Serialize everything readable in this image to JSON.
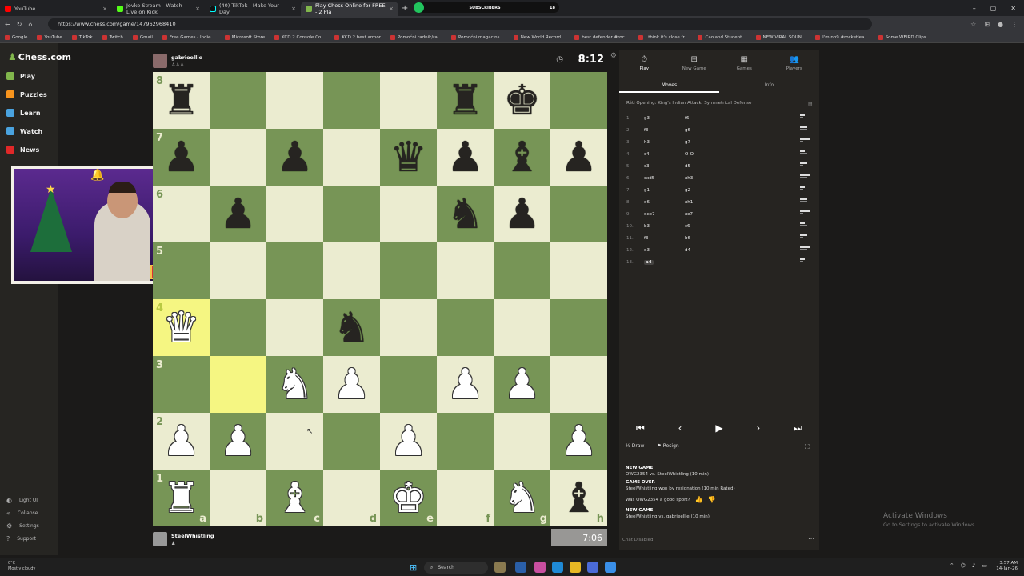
{
  "browser": {
    "tabs": [
      {
        "label": "YouTube",
        "color": "#ff0000"
      },
      {
        "label": "Jovke Stream - Watch Live on Kick",
        "color": "#53fc18"
      },
      {
        "label": "(40) TikTok - Make Your Day",
        "color": "#111111"
      },
      {
        "label": "Play Chess Online for FREE - 2 Pla",
        "color": "#81b64c",
        "active": true
      }
    ],
    "subscribers_label": "SUBSCRIBERS",
    "subscribers_count": "18",
    "url": "https://www.chess.com/game/147962968410",
    "bookmarks": [
      "Google",
      "YouTube",
      "TikTok",
      "Twitch",
      "Gmail",
      "Free Games - Indie...",
      "Microsoft Store",
      "KCD 2 Console Co...",
      "KCD 2 best armor",
      "Pomoćni radnik/ra...",
      "Pomoćni magacins...",
      "New World Record...",
      "best defender #roc...",
      "I think it's close fr...",
      "Caoland Student...",
      "NEW VIRAL SOUN...",
      "I'm no9 #rocketlea...",
      "Some WEIRD Clips..."
    ]
  },
  "sidebar": {
    "logo": "Chess.com",
    "nav": [
      {
        "label": "Play",
        "icon": "play-icon",
        "color": "#81b64c"
      },
      {
        "label": "Puzzles",
        "icon": "puzzle-icon",
        "color": "#f7941d"
      },
      {
        "label": "Learn",
        "icon": "learn-icon",
        "color": "#4aa3df"
      },
      {
        "label": "Watch",
        "icon": "watch-icon",
        "color": "#4aa3df"
      },
      {
        "label": "News",
        "icon": "news-icon",
        "color": "#e02828"
      }
    ],
    "bottom": [
      "Light UI",
      "Collapse",
      "Settings",
      "Support"
    ]
  },
  "game": {
    "top_player": "gabrieellie",
    "top_clock": "8:12",
    "bottom_player": "SteelWhistling",
    "bottom_clock": "7:06",
    "files": [
      "a",
      "b",
      "c",
      "d",
      "e",
      "f",
      "g",
      "h"
    ],
    "ranks": [
      "8",
      "7",
      "6",
      "5",
      "4",
      "3",
      "2",
      "1"
    ],
    "board": [
      [
        "bR",
        "",
        "",
        "",
        "",
        "bR",
        "bK",
        ""
      ],
      [
        "bP",
        "",
        "bP",
        "",
        "bQ",
        "bP",
        "bB",
        "bP"
      ],
      [
        "",
        "bP",
        "",
        "",
        "",
        "bN",
        "bP",
        ""
      ],
      [
        "",
        "",
        "",
        "",
        "",
        "",
        "",
        ""
      ],
      [
        "wQ",
        "",
        "",
        "bN",
        "",
        "",
        "",
        ""
      ],
      [
        "",
        "",
        "wN",
        "wP",
        "",
        "wP",
        "wP",
        ""
      ],
      [
        "wP",
        "wP",
        "",
        "",
        "wP",
        "",
        "",
        "wP"
      ],
      [
        "wR",
        "",
        "wB",
        "",
        "wK",
        "",
        "wN",
        "bB"
      ]
    ],
    "highlights": [
      "a4",
      "b3"
    ]
  },
  "panel": {
    "tabs": [
      {
        "label": "Play",
        "icon": "stopwatch-icon",
        "active": true
      },
      {
        "label": "New Game",
        "icon": "plus-icon"
      },
      {
        "label": "Games",
        "icon": "games-icon"
      },
      {
        "label": "Players",
        "icon": "players-icon"
      }
    ],
    "move_tabs": [
      "Moves",
      "Info"
    ],
    "opening": "Réti Opening: King's Indian Attack, Symmetrical Defense",
    "moves": [
      {
        "n": "1.",
        "w": "g3",
        "b": "f6"
      },
      {
        "n": "2.",
        "w": "f3",
        "b": "g6"
      },
      {
        "n": "3.",
        "w": "h3",
        "b": "g7"
      },
      {
        "n": "4.",
        "w": "c4",
        "b": "O-O"
      },
      {
        "n": "5.",
        "w": "c3",
        "b": "d5"
      },
      {
        "n": "6.",
        "w": "cxd5",
        "b": "xh3"
      },
      {
        "n": "7.",
        "w": "g1",
        "b": "g2"
      },
      {
        "n": "8.",
        "w": "d6",
        "b": "xh1"
      },
      {
        "n": "9.",
        "w": "dxe7",
        "b": "xe7"
      },
      {
        "n": "10.",
        "w": "b3",
        "b": "c6"
      },
      {
        "n": "11.",
        "w": "f3",
        "b": "b6"
      },
      {
        "n": "12.",
        "w": "d3",
        "b": "d4"
      },
      {
        "n": "13.",
        "w": "a4",
        "b": ""
      }
    ],
    "draw_label": "Draw",
    "resign_label": "Resign",
    "log": [
      {
        "head": "NEW GAME",
        "text": "OWG2354 vs. SteelWhistling (10 min)"
      },
      {
        "head": "GAME OVER",
        "text": "SteelWhistling won by resignation (10 min Rated)"
      }
    ],
    "sport_question": "Was OWG2354 a good sport?",
    "new_game": {
      "head": "NEW GAME",
      "text": "SteelWhistling vs. gabrieellie (10 min)"
    },
    "chat_disabled": "Chat Disabled"
  },
  "watermark": {
    "title": "Activate Windows",
    "subtitle": "Go to Settings to activate Windows."
  },
  "taskbar": {
    "weather_temp": "0°C",
    "weather_desc": "Mostly cloudy",
    "search_placeholder": "Search",
    "time": "3:57 AM",
    "date": "14-Jan-26"
  }
}
